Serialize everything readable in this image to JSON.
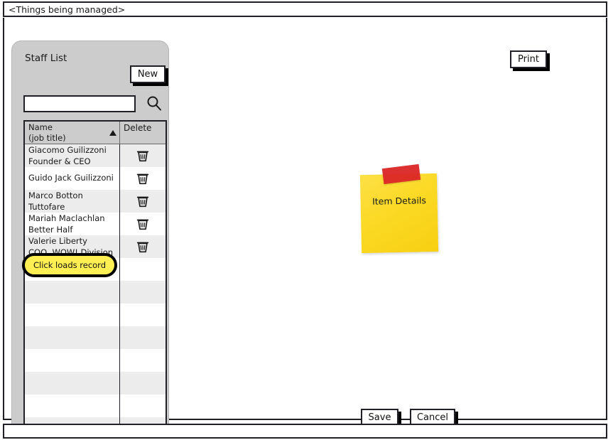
{
  "window": {
    "title": "<Things being managed>"
  },
  "left_panel": {
    "heading": "Staff List",
    "new_button_label": "New",
    "search": {
      "value": "",
      "placeholder": ""
    },
    "search_icon": "magnifier-icon",
    "table": {
      "columns": [
        {
          "header_line1": "Name",
          "header_line2": "(job title)",
          "sort_indicator": "ascending"
        },
        {
          "header_line1": "Delete",
          "header_line2": ""
        }
      ],
      "rows": [
        {
          "name": "Giacomo Guilizzoni",
          "job_title": "Founder & CEO",
          "delete_icon": "trash-icon"
        },
        {
          "name": "Guido Jack Guilizzoni",
          "job_title": "",
          "delete_icon": "trash-icon"
        },
        {
          "name": "Marco Botton",
          "job_title": "Tuttofare",
          "delete_icon": "trash-icon"
        },
        {
          "name": "Mariah Maclachlan",
          "job_title": "Better Half",
          "delete_icon": "trash-icon"
        },
        {
          "name": "Valerie Liberty",
          "job_title": "COO, WOW! Division",
          "delete_icon": "trash-icon"
        },
        {
          "name": "",
          "job_title": "",
          "delete_icon": ""
        },
        {
          "name": "",
          "job_title": "",
          "delete_icon": ""
        },
        {
          "name": "",
          "job_title": "",
          "delete_icon": ""
        },
        {
          "name": "",
          "job_title": "",
          "delete_icon": ""
        },
        {
          "name": "",
          "job_title": "",
          "delete_icon": ""
        },
        {
          "name": "",
          "job_title": "",
          "delete_icon": ""
        },
        {
          "name": "",
          "job_title": "",
          "delete_icon": ""
        },
        {
          "name": "",
          "job_title": "",
          "delete_icon": ""
        }
      ]
    },
    "annotation": {
      "text": "Click loads record"
    }
  },
  "main_area": {
    "print_button_label": "Print",
    "sticky_note": {
      "label": "Item Details",
      "note_color": "#fbd924",
      "tape_color": "#dc2626"
    },
    "save_button_label": "Save",
    "cancel_button_label": "Cancel"
  },
  "colors": {
    "panel_gray": "#cccccc",
    "row_stripe": "#ececec",
    "annotation_yellow": "#ffef52",
    "outline": "#221f26"
  },
  "status_bar": {
    "text": ""
  }
}
